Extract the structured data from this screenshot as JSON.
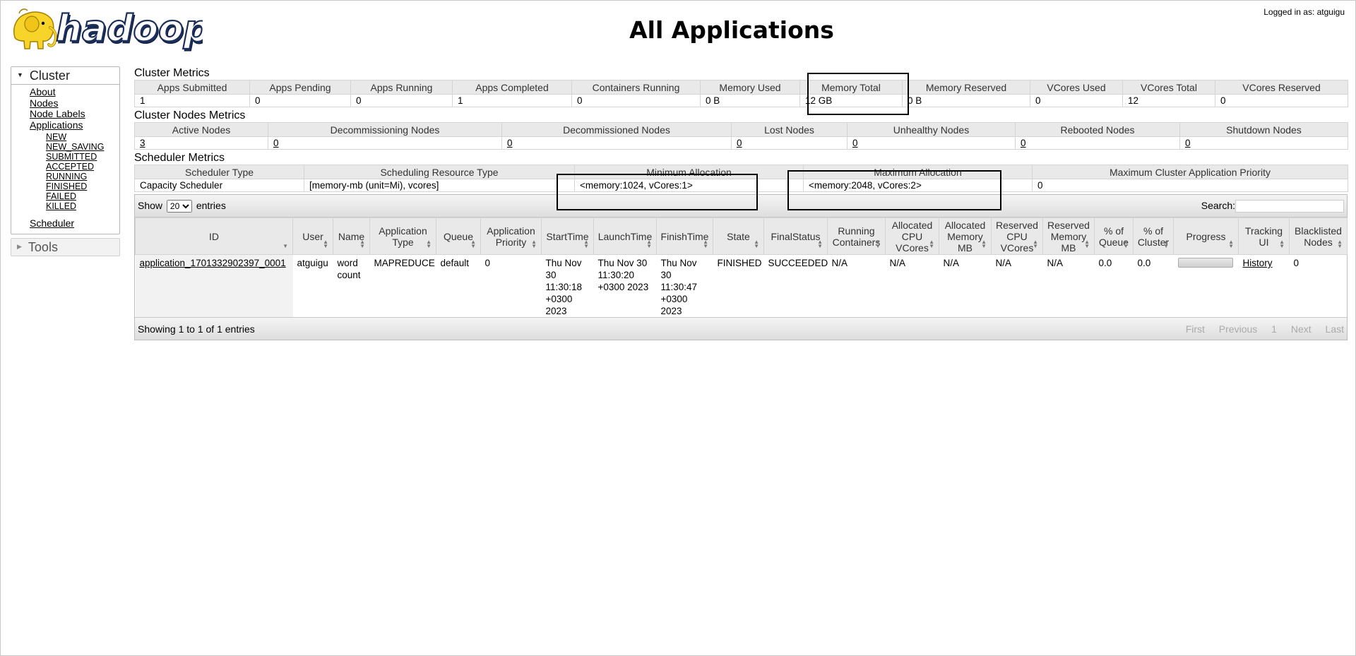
{
  "header": {
    "logo_text": "hadoop",
    "title": "All Applications",
    "login": "Logged in as: atguigu"
  },
  "nav": {
    "cluster_label": "Cluster",
    "cluster_links": [
      "About",
      "Nodes",
      "Node Labels",
      "Applications"
    ],
    "app_states": [
      "NEW",
      "NEW_SAVING",
      "SUBMITTED",
      "ACCEPTED",
      "RUNNING",
      "FINISHED",
      "FAILED",
      "KILLED"
    ],
    "scheduler_label": "Scheduler",
    "tools_label": "Tools"
  },
  "cluster_metrics": {
    "title": "Cluster Metrics",
    "headers": [
      "Apps Submitted",
      "Apps Pending",
      "Apps Running",
      "Apps Completed",
      "Containers Running",
      "Memory Used",
      "Memory Total",
      "Memory Reserved",
      "VCores Used",
      "VCores Total",
      "VCores Reserved"
    ],
    "values": [
      "1",
      "0",
      "0",
      "1",
      "0",
      "0 B",
      "12 GB",
      "0 B",
      "0",
      "12",
      "0"
    ]
  },
  "nodes_metrics": {
    "title": "Cluster Nodes Metrics",
    "headers": [
      "Active Nodes",
      "Decommissioning Nodes",
      "Decommissioned Nodes",
      "Lost Nodes",
      "Unhealthy Nodes",
      "Rebooted Nodes",
      "Shutdown Nodes"
    ],
    "values": [
      "3",
      "0",
      "0",
      "0",
      "0",
      "0",
      "0"
    ]
  },
  "scheduler_metrics": {
    "title": "Scheduler Metrics",
    "headers": [
      "Scheduler Type",
      "Scheduling Resource Type",
      "Minimum Allocation",
      "Maximum Allocation",
      "Maximum Cluster Application Priority"
    ],
    "values": [
      "Capacity Scheduler",
      "[memory-mb (unit=Mi), vcores]",
      "<memory:1024, vCores:1>",
      "<memory:2048, vCores:2>",
      "0"
    ]
  },
  "apps": {
    "show_label": "Show",
    "entries_label": "entries",
    "page_size": "20",
    "search_label": "Search:",
    "search_value": "",
    "columns": [
      {
        "l1": "ID",
        "l2": ""
      },
      {
        "l1": "User",
        "l2": ""
      },
      {
        "l1": "Name",
        "l2": ""
      },
      {
        "l1": "Application",
        "l2": "Type"
      },
      {
        "l1": "Queue",
        "l2": ""
      },
      {
        "l1": "Application",
        "l2": "Priority"
      },
      {
        "l1": "StartTime",
        "l2": ""
      },
      {
        "l1": "LaunchTime",
        "l2": ""
      },
      {
        "l1": "FinishTime",
        "l2": ""
      },
      {
        "l1": "State",
        "l2": ""
      },
      {
        "l1": "FinalStatus",
        "l2": ""
      },
      {
        "l1": "Running",
        "l2": "Containers"
      },
      {
        "l1": "Allocated",
        "l2": "CPU",
        "l3": "VCores"
      },
      {
        "l1": "Allocated",
        "l2": "Memory",
        "l3": "MB"
      },
      {
        "l1": "Reserved",
        "l2": "CPU",
        "l3": "VCores"
      },
      {
        "l1": "Reserved",
        "l2": "Memory",
        "l3": "MB"
      },
      {
        "l1": "% of",
        "l2": "Queue"
      },
      {
        "l1": "% of",
        "l2": "Cluster"
      },
      {
        "l1": "Progress",
        "l2": ""
      },
      {
        "l1": "Tracking",
        "l2": "UI"
      },
      {
        "l1": "Blacklisted",
        "l2": "Nodes"
      }
    ],
    "rows": [
      {
        "id": "application_1701332902397_0001",
        "user": "atguigu",
        "name": "word count",
        "type": "MAPREDUCE",
        "queue": "default",
        "priority": "0",
        "start": "Thu Nov 30 11:30:18 +0300 2023",
        "launch": "Thu Nov 30 11:30:20 +0300 2023",
        "finish": "Thu Nov 30 11:30:47 +0300 2023",
        "state": "FINISHED",
        "final_status": "SUCCEEDED",
        "running_containers": "N/A",
        "alloc_vcores": "N/A",
        "alloc_mem": "N/A",
        "res_vcores": "N/A",
        "res_mem": "N/A",
        "pct_queue": "0.0",
        "pct_cluster": "0.0",
        "progress": 0,
        "tracking_ui": "History",
        "blacklisted": "0"
      }
    ],
    "info": "Showing 1 to 1 of 1 entries",
    "pager": [
      "First",
      "Previous",
      "1",
      "Next",
      "Last"
    ]
  }
}
